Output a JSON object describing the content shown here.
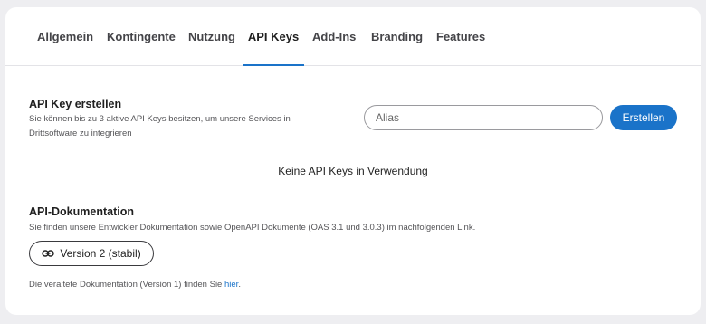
{
  "tabs": [
    {
      "label": "Allgemein",
      "active": false
    },
    {
      "label": "Kontingente",
      "active": false
    },
    {
      "label": "Nutzung",
      "active": false
    },
    {
      "label": "API Keys",
      "active": true
    },
    {
      "label": "Add-Ins",
      "active": false
    },
    {
      "label": "Branding",
      "active": false
    },
    {
      "label": "Features",
      "active": false
    }
  ],
  "create": {
    "title": "API Key erstellen",
    "description": "Sie können bis zu 3 aktive API Keys besitzen, um unsere Services in Drittsoftware zu integrieren",
    "alias_placeholder": "Alias",
    "alias_value": "",
    "button_label": "Erstellen"
  },
  "empty_state": "Keine API Keys in Verwendung",
  "docs": {
    "title": "API-Dokumentation",
    "description": "Sie finden unsere Entwickler Dokumentation sowie OpenAPI Dokumente (OAS 3.1 und 3.0.3) im nachfolgenden Link.",
    "version_button": {
      "icon": "link-icon",
      "label": "Version 2 (stabil)"
    },
    "legacy_text": "Die veraltete Dokumentation (Version 1) finden Sie ",
    "legacy_link": "hier",
    "legacy_end": "."
  },
  "colors": {
    "accent": "#1a73c9",
    "background": "#eeeef1",
    "card": "#ffffff"
  }
}
